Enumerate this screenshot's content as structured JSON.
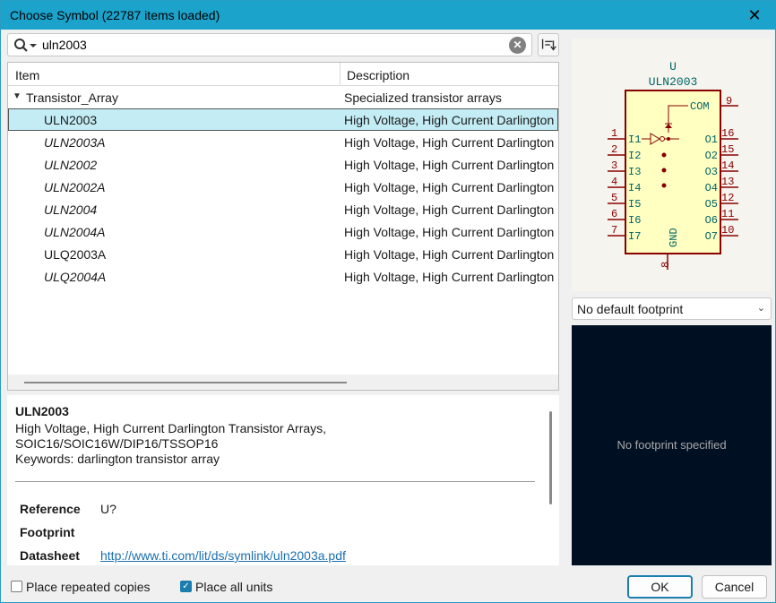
{
  "window": {
    "title": "Choose Symbol (22787 items loaded)",
    "close_glyph": "✕"
  },
  "search": {
    "value": "uln2003",
    "placeholder": ""
  },
  "tree": {
    "columns": [
      "Item",
      "Description"
    ],
    "group": {
      "name": "Transistor_Array",
      "description": "Specialized transistor arrays"
    },
    "rows": [
      {
        "name": "ULN2003",
        "description": "High Voltage, High Current Darlington",
        "selected": true,
        "italic": false
      },
      {
        "name": "ULN2003A",
        "description": "High Voltage, High Current Darlington",
        "italic": true
      },
      {
        "name": "ULN2002",
        "description": "High Voltage, High Current Darlington",
        "italic": true
      },
      {
        "name": "ULN2002A",
        "description": "High Voltage, High Current Darlington",
        "italic": true
      },
      {
        "name": "ULN2004",
        "description": "High Voltage, High Current Darlington",
        "italic": true
      },
      {
        "name": "ULN2004A",
        "description": "High Voltage, High Current Darlington",
        "italic": true
      },
      {
        "name": "ULQ2003A",
        "description": "High Voltage, High Current Darlington",
        "italic": false
      },
      {
        "name": "ULQ2004A",
        "description": "High Voltage, High Current Darlington",
        "italic": true
      }
    ]
  },
  "details": {
    "name": "ULN2003",
    "description_line1": "High Voltage, High Current Darlington Transistor Arrays,",
    "description_line2": "SOIC16/SOIC16W/DIP16/TSSOP16",
    "keywords": "Keywords: darlington transistor array",
    "reference_label": "Reference",
    "reference_value": "U?",
    "footprint_label": "Footprint",
    "footprint_value": "",
    "datasheet_label": "Datasheet",
    "datasheet_value": "http://www.ti.com/lit/ds/symlink/uln2003a.pdf"
  },
  "symbol": {
    "reference": "U",
    "value": "ULN2003",
    "com_label": "COM",
    "gnd_label": "GND",
    "com_pin": "9",
    "gnd_pin": "8",
    "inputs": [
      {
        "label": "I1",
        "pin": "1"
      },
      {
        "label": "I2",
        "pin": "2"
      },
      {
        "label": "I3",
        "pin": "3"
      },
      {
        "label": "I4",
        "pin": "4"
      },
      {
        "label": "I5",
        "pin": "5"
      },
      {
        "label": "I6",
        "pin": "6"
      },
      {
        "label": "I7",
        "pin": "7"
      }
    ],
    "outputs": [
      {
        "label": "O1",
        "pin": "16"
      },
      {
        "label": "O2",
        "pin": "15"
      },
      {
        "label": "O3",
        "pin": "14"
      },
      {
        "label": "O4",
        "pin": "13"
      },
      {
        "label": "O5",
        "pin": "12"
      },
      {
        "label": "O6",
        "pin": "11"
      },
      {
        "label": "O7",
        "pin": "10"
      }
    ],
    "colors": {
      "outline": "#8a0000",
      "fill": "#ffffc2",
      "pin_text": "#8a0000",
      "label_text": "#006464"
    }
  },
  "footprint": {
    "selected": "No default footprint",
    "message": "No footprint specified"
  },
  "options": {
    "place_repeated": {
      "label": "Place repeated copies",
      "checked": false
    },
    "place_all_units": {
      "label": "Place all units",
      "checked": true
    }
  },
  "buttons": {
    "ok": "OK",
    "cancel": "Cancel"
  },
  "colors": {
    "titlebar": "#1ba3cc",
    "selection": "#c3ecf5",
    "footprint_bg": "#001023",
    "link": "#1a6fb0"
  }
}
